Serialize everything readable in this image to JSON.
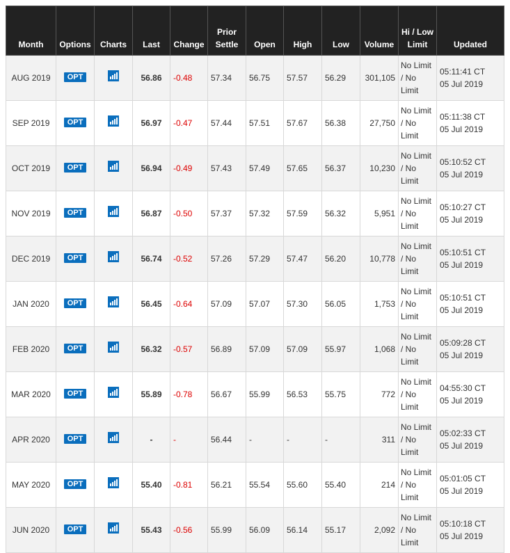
{
  "headers": {
    "month": "Month",
    "options": "Options",
    "charts": "Charts",
    "last": "Last",
    "change": "Change",
    "prior_settle": "Prior Settle",
    "open": "Open",
    "high": "High",
    "low": "Low",
    "volume": "Volume",
    "hilow": "Hi / Low Limit",
    "updated": "Updated"
  },
  "colors": {
    "header_bg": "#222222",
    "opt_button": "#0a6ebd",
    "change_negative": "#dd0000"
  },
  "icons": {
    "charts": "bar-chart-icon"
  },
  "rows": [
    {
      "month": "AUG 2019",
      "opt": "OPT",
      "last": "56.86",
      "change": "-0.48",
      "prior": "57.34",
      "open": "56.75",
      "high": "57.57",
      "low": "56.29",
      "volume": "301,105",
      "limit1": "No Limit",
      "limit2": "/ No",
      "limit3": "Limit",
      "time": "05:11:41 CT",
      "date": "05 Jul 2019"
    },
    {
      "month": "SEP 2019",
      "opt": "OPT",
      "last": "56.97",
      "change": "-0.47",
      "prior": "57.44",
      "open": "57.51",
      "high": "57.67",
      "low": "56.38",
      "volume": "27,750",
      "limit1": "No Limit",
      "limit2": "/ No",
      "limit3": "Limit",
      "time": "05:11:38 CT",
      "date": "05 Jul 2019"
    },
    {
      "month": "OCT 2019",
      "opt": "OPT",
      "last": "56.94",
      "change": "-0.49",
      "prior": "57.43",
      "open": "57.49",
      "high": "57.65",
      "low": "56.37",
      "volume": "10,230",
      "limit1": "No Limit",
      "limit2": "/ No",
      "limit3": "Limit",
      "time": "05:10:52 CT",
      "date": "05 Jul 2019"
    },
    {
      "month": "NOV 2019",
      "opt": "OPT",
      "last": "56.87",
      "change": "-0.50",
      "prior": "57.37",
      "open": "57.32",
      "high": "57.59",
      "low": "56.32",
      "volume": "5,951",
      "limit1": "No Limit",
      "limit2": "/ No",
      "limit3": "Limit",
      "time": "05:10:27 CT",
      "date": "05 Jul 2019"
    },
    {
      "month": "DEC 2019",
      "opt": "OPT",
      "last": "56.74",
      "change": "-0.52",
      "prior": "57.26",
      "open": "57.29",
      "high": "57.47",
      "low": "56.20",
      "volume": "10,778",
      "limit1": "No Limit",
      "limit2": "/ No",
      "limit3": "Limit",
      "time": "05:10:51 CT",
      "date": "05 Jul 2019"
    },
    {
      "month": "JAN 2020",
      "opt": "OPT",
      "last": "56.45",
      "change": "-0.64",
      "prior": "57.09",
      "open": "57.07",
      "high": "57.30",
      "low": "56.05",
      "volume": "1,753",
      "limit1": "No Limit",
      "limit2": "/ No",
      "limit3": "Limit",
      "time": "05:10:51 CT",
      "date": "05 Jul 2019"
    },
    {
      "month": "FEB 2020",
      "opt": "OPT",
      "last": "56.32",
      "change": "-0.57",
      "prior": "56.89",
      "open": "57.09",
      "high": "57.09",
      "low": "55.97",
      "volume": "1,068",
      "limit1": "No Limit",
      "limit2": "/ No",
      "limit3": "Limit",
      "time": "05:09:28 CT",
      "date": "05 Jul 2019"
    },
    {
      "month": "MAR 2020",
      "opt": "OPT",
      "last": "55.89",
      "change": "-0.78",
      "prior": "56.67",
      "open": "55.99",
      "high": "56.53",
      "low": "55.75",
      "volume": "772",
      "limit1": "No Limit",
      "limit2": "/ No",
      "limit3": "Limit",
      "time": "04:55:30 CT",
      "date": "05 Jul 2019"
    },
    {
      "month": "APR 2020",
      "opt": "OPT",
      "last": "-",
      "change": "-",
      "prior": "56.44",
      "open": "-",
      "high": "-",
      "low": "-",
      "volume": "311",
      "limit1": "No Limit",
      "limit2": "/ No",
      "limit3": "Limit",
      "time": "05:02:33 CT",
      "date": "05 Jul 2019"
    },
    {
      "month": "MAY 2020",
      "opt": "OPT",
      "last": "55.40",
      "change": "-0.81",
      "prior": "56.21",
      "open": "55.54",
      "high": "55.60",
      "low": "55.40",
      "volume": "214",
      "limit1": "No Limit",
      "limit2": "/ No",
      "limit3": "Limit",
      "time": "05:01:05 CT",
      "date": "05 Jul 2019"
    },
    {
      "month": "JUN 2020",
      "opt": "OPT",
      "last": "55.43",
      "change": "-0.56",
      "prior": "55.99",
      "open": "56.09",
      "high": "56.14",
      "low": "55.17",
      "volume": "2,092",
      "limit1": "No Limit",
      "limit2": "/ No",
      "limit3": "Limit",
      "time": "05:10:18 CT",
      "date": "05 Jul 2019"
    }
  ]
}
